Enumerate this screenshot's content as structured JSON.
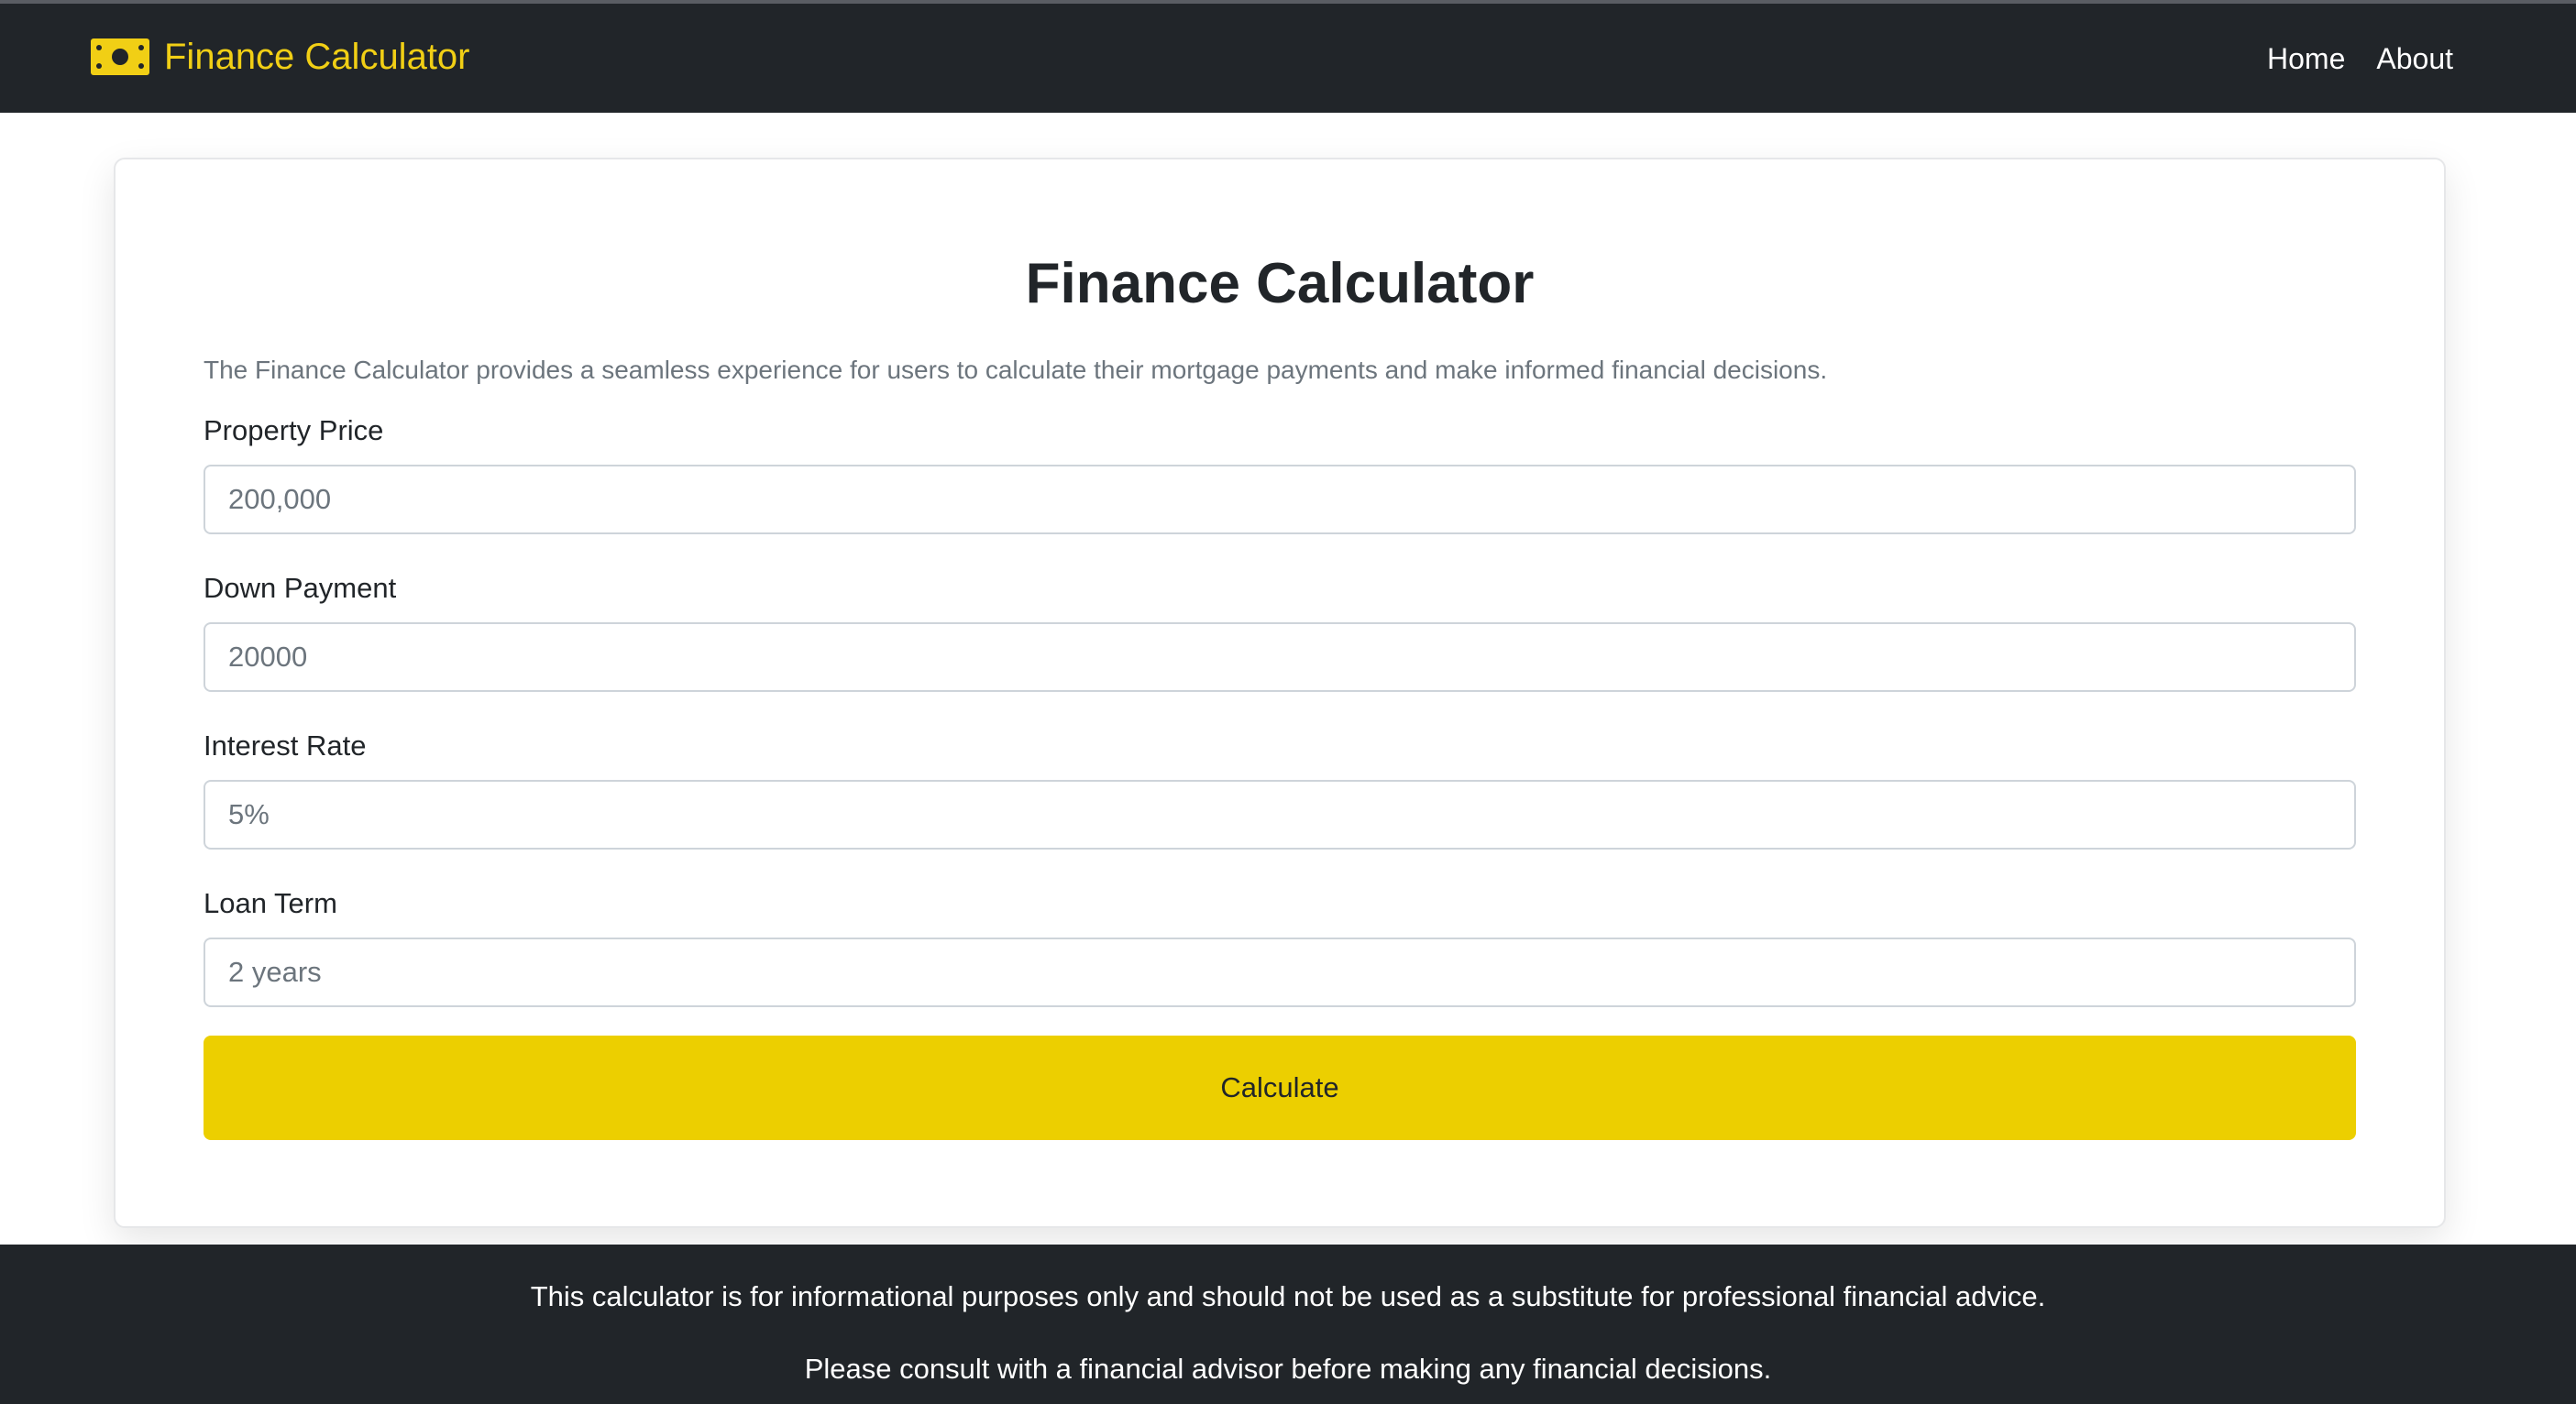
{
  "navbar": {
    "brand_icon": "money-bill-icon",
    "brand_text": "Finance Calculator",
    "brand_color": "#f1cf15",
    "links": [
      {
        "label": "Home"
      },
      {
        "label": "About"
      }
    ]
  },
  "main": {
    "title": "Finance Calculator",
    "description": "The Finance Calculator provides a seamless experience for users to calculate their mortgage payments and make informed financial decisions.",
    "fields": [
      {
        "label": "Property Price",
        "placeholder": "200,000",
        "value": ""
      },
      {
        "label": "Down Payment",
        "placeholder": "20000",
        "value": ""
      },
      {
        "label": "Interest Rate",
        "placeholder": "5%",
        "value": ""
      },
      {
        "label": "Loan Term",
        "placeholder": "2 years",
        "value": ""
      }
    ],
    "calculate_label": "Calculate",
    "accent_color": "#eccf00"
  },
  "footer": {
    "line1": "This calculator is for informational purposes only and should not be used as a substitute for professional financial advice.",
    "line2": "Please consult with a financial advisor before making any financial decisions."
  }
}
